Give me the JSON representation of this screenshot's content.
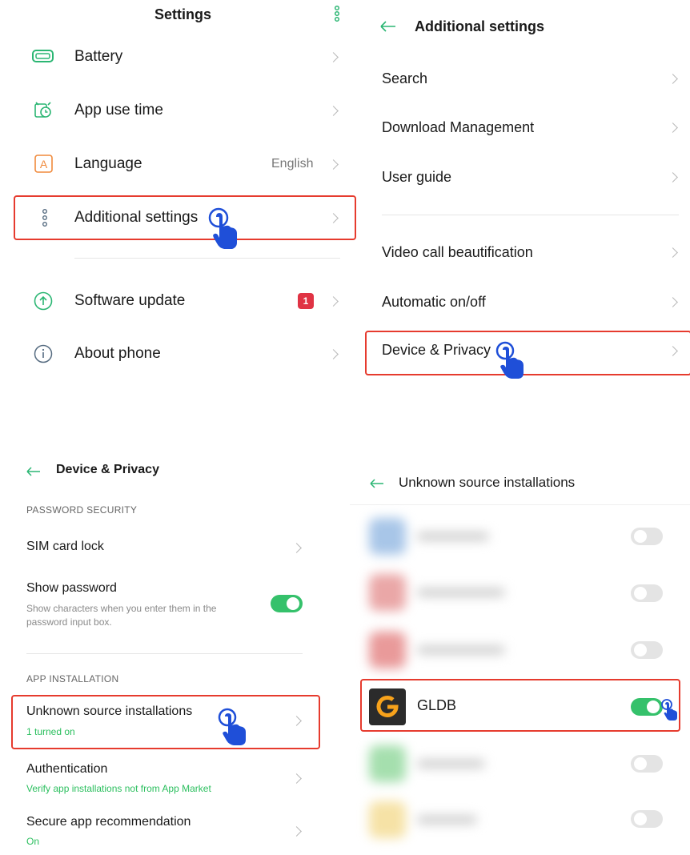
{
  "panel1": {
    "title": "Settings",
    "items": [
      {
        "label": "Battery",
        "icon": "battery-icon"
      },
      {
        "label": "App use time",
        "icon": "clock-icon"
      },
      {
        "label": "Language",
        "icon": "language-icon",
        "value": "English"
      },
      {
        "label": "Additional settings",
        "icon": "dots-icon"
      },
      {
        "label": "Software update",
        "icon": "upload-icon",
        "badge": "1"
      },
      {
        "label": "About phone",
        "icon": "info-icon"
      }
    ]
  },
  "panel2": {
    "title": "Additional settings",
    "items": [
      {
        "label": "Search"
      },
      {
        "label": "Download Management"
      },
      {
        "label": "User guide"
      },
      {
        "label": "Video call beautification"
      },
      {
        "label": "Automatic on/off"
      },
      {
        "label": "Device & Privacy"
      }
    ]
  },
  "panel3": {
    "title": "Device & Privacy",
    "section1": "PASSWORD SECURITY",
    "sim_lock": "SIM card lock",
    "show_password": {
      "label": "Show password",
      "description": "Show characters when you enter them in the password input box.",
      "enabled": true
    },
    "section2": "APP INSTALLATION",
    "unknown_sources": {
      "label": "Unknown source installations",
      "sub": "1 turned on"
    },
    "authentication": {
      "label": "Authentication",
      "sub": "Verify app installations not from App Market"
    },
    "secure_recommendation": {
      "label": "Secure app recommendation",
      "sub": "On"
    }
  },
  "panel4": {
    "title": "Unknown source installations",
    "app": {
      "name": "GLDB",
      "enabled": true
    },
    "colors": {
      "accent": "#35c16b",
      "highlight": "#e63b2e",
      "pointer": "#1f4fd8"
    }
  }
}
